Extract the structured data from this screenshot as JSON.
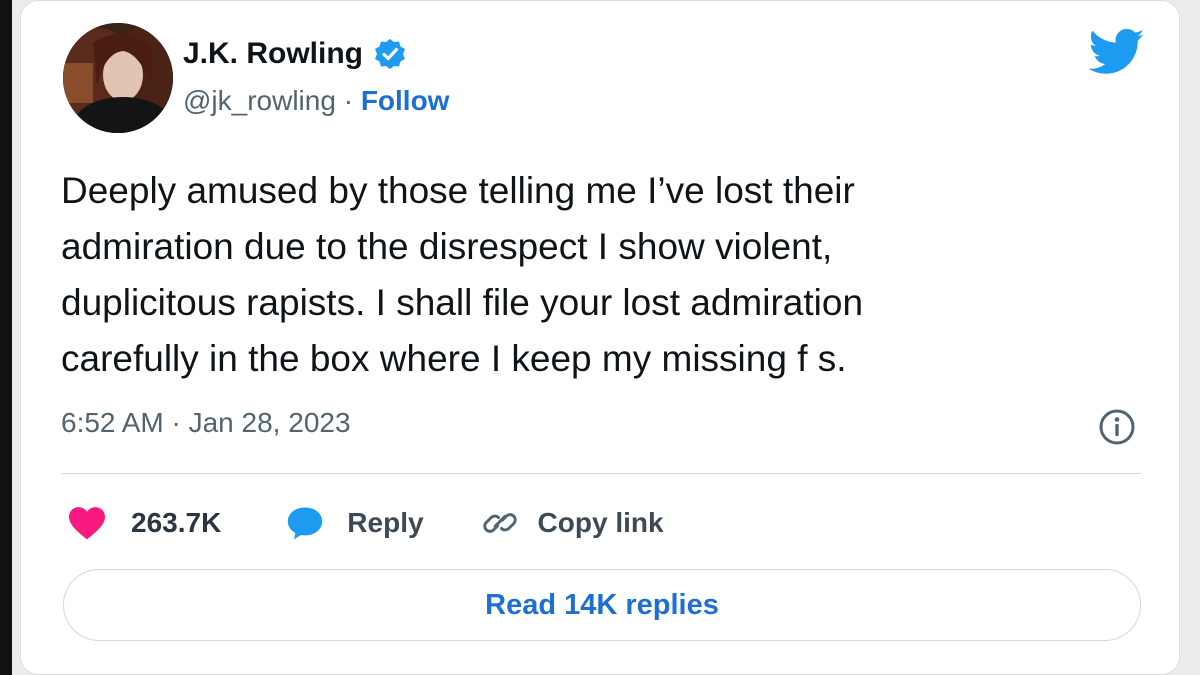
{
  "author": {
    "name": "J.K. Rowling",
    "handle": "@jk_rowling",
    "separator": " · ",
    "follow_label": "Follow",
    "verified": true
  },
  "tweet": {
    "text": "Deeply amused by those telling me I’ve lost their\nadmiration due to the disrespect I show violent,\nduplicitous rapists. I shall file your lost admiration\ncarefully in the box where I keep my missing f      s.",
    "timestamp": "6:52 AM · Jan 28, 2023"
  },
  "actions": {
    "likes": "263.7K",
    "reply_label": "Reply",
    "copy_link_label": "Copy link"
  },
  "footer": {
    "read_replies_label": "Read 14K replies"
  },
  "colors": {
    "twitter_blue": "#1d9bf0",
    "link_blue": "#1d6fd6",
    "like_red": "#f91880",
    "text": "#0f1419",
    "muted": "#536471"
  },
  "icons": {
    "verified": "verified-badge-icon",
    "bird": "twitter-bird-icon",
    "info": "info-icon",
    "heart": "heart-icon",
    "reply": "reply-bubble-icon",
    "link": "link-icon"
  }
}
